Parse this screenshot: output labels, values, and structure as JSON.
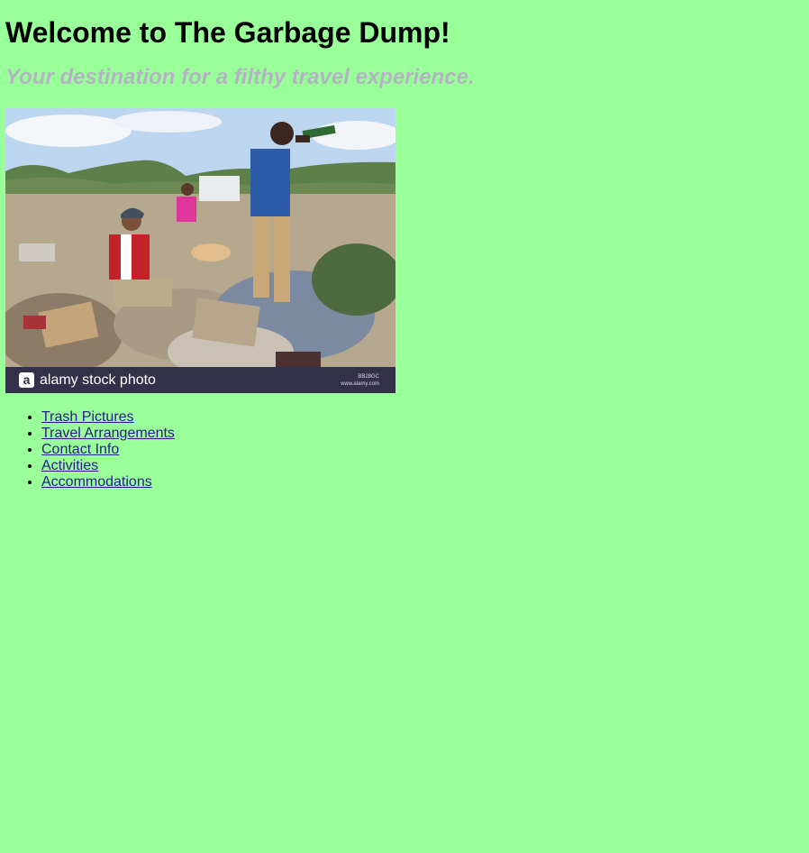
{
  "header": {
    "title": "Welcome to The Garbage Dump!",
    "subtitle": "Your destination for a filthy travel experience."
  },
  "photo": {
    "description_icon": "stock-photo",
    "watermark_logo_letter": "a",
    "watermark_text": "alamy stock photo",
    "stock_id": "BB28GC",
    "stock_site": "www.alamy.com"
  },
  "nav": {
    "items": [
      {
        "label": "Trash Pictures"
      },
      {
        "label": "Travel Arrangements"
      },
      {
        "label": "Contact Info"
      },
      {
        "label": "Activities"
      },
      {
        "label": "Accommodations"
      }
    ]
  },
  "colors": {
    "background": "#99ff99",
    "subtitle": "#b3b3c2",
    "link": "#2a1a8a",
    "watermark_bar": "#33304a"
  }
}
